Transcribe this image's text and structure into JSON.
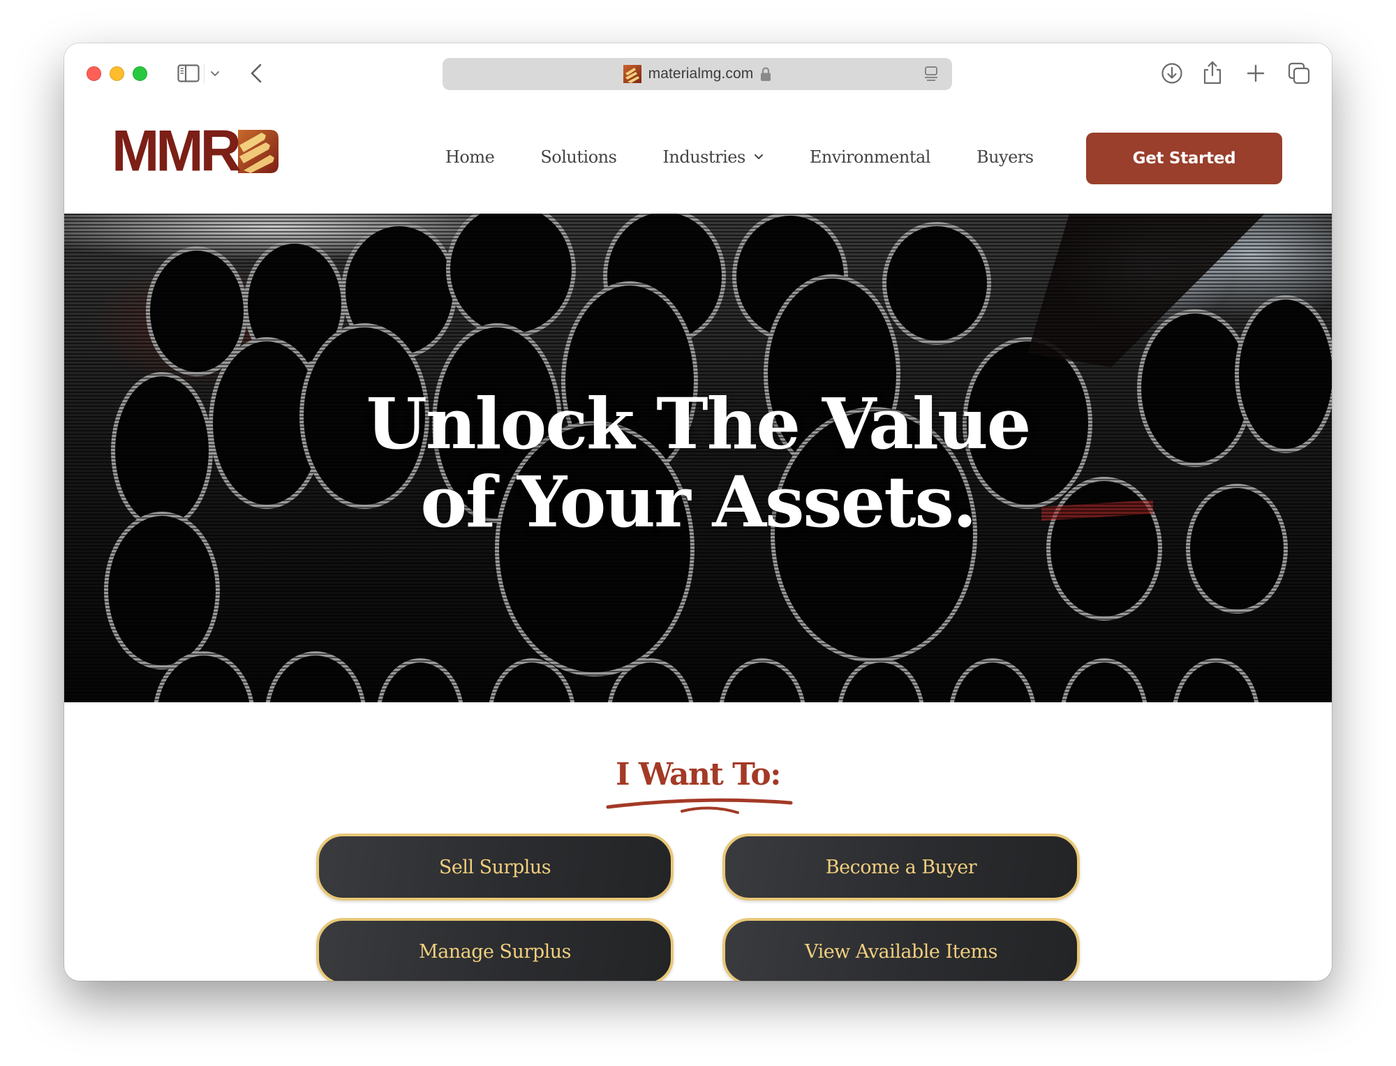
{
  "browser": {
    "url": "materialmg.com",
    "secure": true,
    "toolbar_icons": [
      "sidebar-icon",
      "chevron-down-icon",
      "back-arrow-icon",
      "download-icon",
      "share-icon",
      "plus-icon",
      "tabs-overview-icon"
    ]
  },
  "site": {
    "logo_text": "MMR",
    "brand_color": "#993f2c",
    "logo_color": "#7c1f16",
    "nav": [
      {
        "label": "Home"
      },
      {
        "label": "Solutions"
      },
      {
        "label": "Industries",
        "has_dropdown": true
      },
      {
        "label": "Environmental"
      },
      {
        "label": "Buyers"
      }
    ],
    "cta_label": "Get Started"
  },
  "hero": {
    "title_line1": "Unlock The Value",
    "title_line2": "of Your Assets."
  },
  "want": {
    "title": "I Want To:",
    "accent_color": "#a33a26",
    "button_border_color": "#e8c878",
    "buttons": [
      {
        "label": "Sell Surplus"
      },
      {
        "label": "Become a Buyer"
      },
      {
        "label": "Manage Surplus"
      },
      {
        "label": "View Available Items"
      }
    ]
  }
}
